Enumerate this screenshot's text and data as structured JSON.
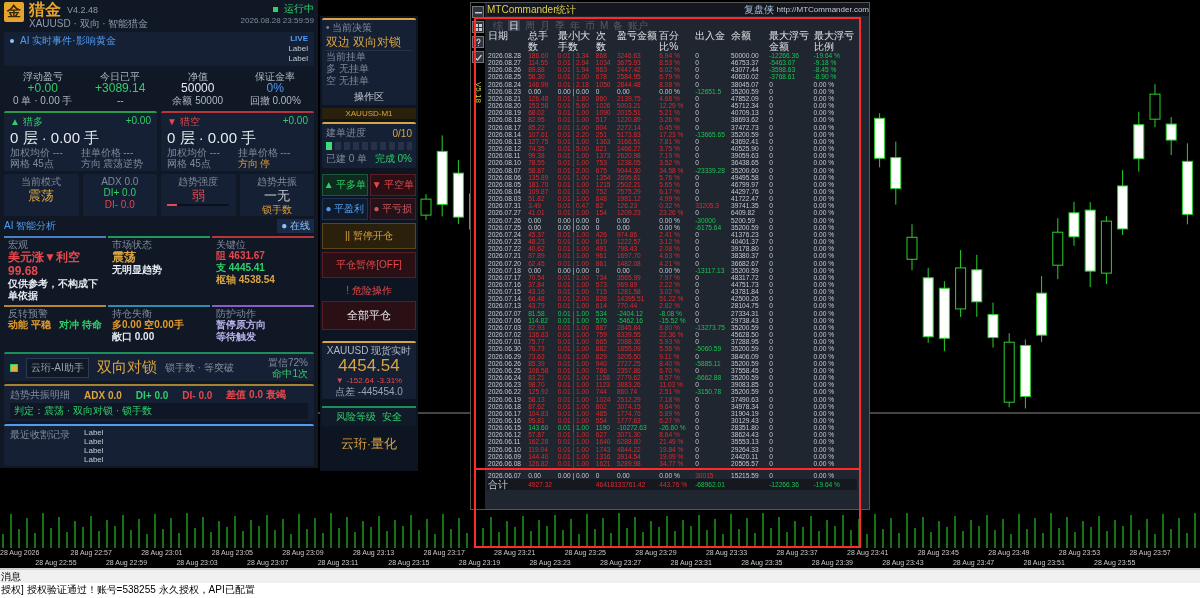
{
  "header": {
    "logo": "金",
    "title": "猎金",
    "version": "V4.2.48",
    "subtitle": "XAUUSD · 双向 · 智能猎金",
    "status": "运行中",
    "running": true,
    "datetime": "2026.08.28 23:59:59"
  },
  "news": {
    "text": "AI 实时事件·影响黄金",
    "badge": "LIVE",
    "labels": [
      "Label",
      "Label"
    ]
  },
  "stats": [
    {
      "label": "浮动盈亏",
      "value": "+0.00",
      "sub": "0 单 · 0.00 手",
      "color": "#2fcf6a"
    },
    {
      "label": "今日已平",
      "value": "+3089.14",
      "sub": "--",
      "color": "#2fcf6a"
    },
    {
      "label": "净值",
      "value": "50000",
      "sub": "余额 50000",
      "color": "#e6ebf2"
    },
    {
      "label": "保证金率",
      "value": "0%",
      "sub": "回撤 0.00%",
      "color": "#4f9cf0"
    }
  ],
  "sides": [
    {
      "kind": "long",
      "arrow": "▲",
      "name": "猎多",
      "pnl": "+0.00",
      "position": "0 层 · 0.00 手",
      "fields": [
        {
          "text": "加权均价 ---",
          "highlight": false
        },
        {
          "text": "挂单价格 ---",
          "highlight": false
        },
        {
          "text": "网格 45点",
          "highlight": false
        },
        {
          "text": "方向 震荡逆势",
          "highlight": false
        }
      ]
    },
    {
      "kind": "short",
      "arrow": "▼",
      "name": "猎空",
      "pnl": "+0.00",
      "position": "0 层 · 0.00 手",
      "fields": [
        {
          "text": "加权均价 ---",
          "highlight": false
        },
        {
          "text": "挂单价格 ---",
          "highlight": false
        },
        {
          "text": "网格 45点",
          "highlight": false
        },
        {
          "text": "方向 停",
          "highlight": true
        }
      ]
    }
  ],
  "indicators": [
    {
      "kind": "mode",
      "label": "当前模式",
      "value": "震荡"
    },
    {
      "kind": "adx",
      "label": "ADX 0.0",
      "plus": "DI+ 0.0",
      "minus": "DI- 0.0"
    },
    {
      "kind": "strength",
      "label": "趋势强度",
      "value": "弱",
      "level": 0.15
    },
    {
      "kind": "resonance",
      "label": "趋势共振",
      "value": "一无",
      "sub": "锁手数"
    }
  ],
  "ai": {
    "title": "AI 智能分析",
    "badge": "● 在线",
    "cards": [
      {
        "kind": "headline",
        "title": "宏观",
        "color": "#4a7fc1",
        "lines": [
          {
            "text": "美元涨▼利空 99.68",
            "color": "#e5484d"
          },
          {
            "text": "仅供参考，不构成下单依据",
            "color": "#e6ebf2"
          }
        ]
      },
      {
        "kind": "headline",
        "title": "市场状态",
        "color": "#1b9a5a",
        "lines": [
          {
            "text": "震荡",
            "color": "#d9a441"
          },
          {
            "text": "无明显趋势",
            "color": "#e6ebf2"
          }
        ]
      },
      {
        "kind": "list",
        "title": "关键位",
        "color": "#b8353a",
        "lines": [
          {
            "text": "阻 4631.67",
            "color": "#e5484d"
          },
          {
            "text": "支 4445.41",
            "color": "#2fcf6a"
          },
          {
            "text": "枢轴 4538.54",
            "color": "#d9a441"
          }
        ]
      },
      {
        "kind": "list",
        "title": "反转预警",
        "color": "#b8862f",
        "lines": [
          {
            "text": "动能 平稳",
            "color": "#e39b2d"
          },
          {
            "text": "对冲 待命",
            "color": "#2fcf6a"
          }
        ]
      },
      {
        "kind": "list",
        "title": "持仓失衡",
        "color": "#2a8fb0",
        "lines": [
          {
            "text": "多0.00 空0.00手",
            "color": "#e39b2d"
          },
          {
            "text": "敞口 0.00",
            "color": "#e6ebf2"
          }
        ]
      },
      {
        "kind": "list",
        "title": "防护动作",
        "color": "#8a5cc8",
        "lines": [
          {
            "text": "暂停原方向",
            "color": "#b9b3ec"
          },
          {
            "text": "等待触发",
            "color": "#b9b3ec"
          }
        ]
      }
    ]
  },
  "strategy": {
    "assistant": "云珩-AI助手",
    "name": "双向对锁",
    "mode": "锁手数 · 等突破",
    "confidence": "置信72%",
    "hits": "命中1次"
  },
  "resonance": {
    "title": "趋势共振明细",
    "items": [
      {
        "text": "ADX 0.0",
        "color": "#d9a441"
      },
      {
        "text": "DI+ 0.0",
        "color": "#2fcf6a"
      },
      {
        "text": "DI- 0.0",
        "color": "#e5484d"
      },
      {
        "text": "差值 0.0 衰竭",
        "color": "#e5484d"
      }
    ],
    "verdict": "判定：震荡 · 双向对锁 · 锁手数"
  },
  "harvest_log": {
    "title": "最近收割记录",
    "entries": [
      "Label",
      "Label",
      "Label",
      "Label"
    ]
  },
  "decision": {
    "title": "• 当前决策",
    "value": "双边 双向对锁",
    "pending_title": "当前挂单",
    "pending": [
      "多 无挂单",
      "空 无挂单"
    ],
    "footer": "操作区"
  },
  "symbol": "XAUUSD-M1",
  "progress": {
    "title": "建单进度",
    "count": "0/10",
    "level": 0.1,
    "built": "已建 0 单",
    "done": "完成 0%"
  },
  "actions": [
    {
      "label": "▲ 平多单",
      "kind": "close-long"
    },
    {
      "label": "▼ 平空单",
      "kind": "close-short"
    },
    {
      "label": "● 平盈利",
      "kind": "close-profit"
    },
    {
      "label": "● 平亏损",
      "kind": "close-loss"
    }
  ],
  "pause_buttons": [
    {
      "label": "|| 暂停开仓",
      "kind": "pause-open"
    },
    {
      "label": "平仓暂停[OFF]",
      "kind": "pause-close"
    }
  ],
  "danger": {
    "title": "! 危险操作",
    "button": "全部平仓"
  },
  "quote": {
    "title": "XAUUSD 现货实时",
    "price": "4454.54",
    "arrow": "▼",
    "change": "-152.64",
    "percent": "-3.31%",
    "spread": "点差 -445454.0"
  },
  "risk": {
    "label": "风险等级",
    "value": "安全"
  },
  "brand": "云珩·量化",
  "stats_window": {
    "title": "MTCommander统计",
    "brand": "复盘侠",
    "url": "http://MTCommander.com",
    "version": "V5.18",
    "tabs": [
      {
        "label": "综",
        "selected": false
      },
      {
        "label": "日",
        "selected": true
      },
      {
        "label": "周",
        "selected": false
      },
      {
        "label": "月",
        "selected": false
      },
      {
        "label": "季",
        "selected": false
      },
      {
        "label": "年",
        "selected": false
      },
      {
        "label": "币",
        "selected": false
      },
      {
        "label": "M",
        "selected": false
      },
      {
        "label": "备",
        "selected": false
      },
      {
        "label": "账户",
        "selected": false
      }
    ],
    "columns": [
      "日期",
      "总手数",
      "最小|大手数",
      "次数",
      "盈亏金额",
      "百分比%",
      "出入金",
      "余额",
      "最大浮亏金额",
      "最大浮亏比例"
    ],
    "rows": [
      {
        "kind": "profit",
        "cells": [
          "2026.08.28",
          "186.60",
          "0.01 | 3.34",
          "868",
          "3246.63",
          "6.94 %"
        ],
        "flow": {
          "text": "0",
          "kind": "none"
        },
        "balance": "50000.00",
        "drawdown": {
          "amount": "-12266.36",
          "percent": "-19.64 %",
          "kind": "loss"
        }
      },
      {
        "kind": "profit",
        "cells": [
          "2026.08.27",
          "114.55",
          "0.01 | 2.94",
          "1034",
          "3675.93",
          "8.53 %"
        ],
        "flow": {
          "text": "0",
          "kind": "none"
        },
        "balance": "46753.37",
        "drawdown": {
          "amount": "-5463.07",
          "percent": "-9.18 %",
          "kind": "loss"
        }
      },
      {
        "kind": "profit",
        "cells": [
          "2026.08.26",
          "89.88",
          "0.01 | 1.94",
          "963",
          "2447.42",
          "6.02 %"
        ],
        "flow": {
          "text": "0",
          "kind": "none"
        },
        "balance": "43077.44",
        "drawdown": {
          "amount": "-3598.63",
          "percent": "-8.45 %",
          "kind": "loss"
        }
      },
      {
        "kind": "profit",
        "cells": [
          "2026.08.25",
          "56.30",
          "0.01 | 1.00",
          "678",
          "2584.95",
          "6.79 %"
        ],
        "flow": {
          "text": "0",
          "kind": "none"
        },
        "balance": "40630.02",
        "drawdown": {
          "amount": "-3768.61",
          "percent": "-8.90 %",
          "kind": "loss"
        }
      },
      {
        "kind": "profit",
        "cells": [
          "2026.08.24",
          "146.99",
          "0.01 | 2.18",
          "1050",
          "2844.48",
          "8.08 %"
        ],
        "flow": {
          "text": "0",
          "kind": "none"
        },
        "balance": "38045.07",
        "drawdown": {
          "amount": "0",
          "percent": "0.00 %",
          "kind": "none"
        }
      },
      {
        "kind": "flat",
        "cells": [
          "2026.08.23",
          "0.00",
          "0.00 | 0.00",
          "0",
          "0.00",
          "0.00 %"
        ],
        "flow": {
          "text": "-12651.5",
          "kind": "withdrawal"
        },
        "balance": "35200.59",
        "drawdown": {
          "amount": "0",
          "percent": "0.00 %",
          "kind": "none"
        }
      },
      {
        "kind": "profit",
        "cells": [
          "2026.08.21",
          "126.48",
          "0.01 | 1.80",
          "860",
          "2139.75",
          "4.68 %"
        ],
        "flow": {
          "text": "0",
          "kind": "none"
        },
        "balance": "47852.09",
        "drawdown": {
          "amount": "0",
          "percent": "0.00 %",
          "kind": "none"
        }
      },
      {
        "kind": "profit",
        "cells": [
          "2026.08.20",
          "153.58",
          "0.01 | 5.60",
          "1026",
          "5003.21",
          "12.29 %"
        ],
        "flow": {
          "text": "0",
          "kind": "none"
        },
        "balance": "45712.34",
        "drawdown": {
          "amount": "0",
          "percent": "0.00 %",
          "kind": "none"
        }
      },
      {
        "kind": "profit",
        "cells": [
          "2026.08.19",
          "68.02",
          "0.01 | 1.00",
          "1090",
          "2015.51",
          "5.21 %"
        ],
        "flow": {
          "text": "0",
          "kind": "none"
        },
        "balance": "40709.13",
        "drawdown": {
          "amount": "0",
          "percent": "0.00 %",
          "kind": "none"
        }
      },
      {
        "kind": "profit",
        "cells": [
          "2026.08.18",
          "82.95",
          "0.01 | 1.00",
          "517",
          "1220.89",
          "3.26 %"
        ],
        "flow": {
          "text": "0",
          "kind": "none"
        },
        "balance": "38693.62",
        "drawdown": {
          "amount": "0",
          "percent": "0.00 %",
          "kind": "none"
        }
      },
      {
        "kind": "profit",
        "cells": [
          "2026.08.17",
          "85.22",
          "0.01 | 1.00",
          "804",
          "2272.14",
          "6.45 %"
        ],
        "flow": {
          "text": "0",
          "kind": "none"
        },
        "balance": "37472.73",
        "drawdown": {
          "amount": "0",
          "percent": "0.00 %",
          "kind": "none"
        }
      },
      {
        "kind": "profit",
        "cells": [
          "2026.08.14",
          "107.61",
          "0.01 | 2.20",
          "251",
          "5173.83",
          "17.23 %"
        ],
        "flow": {
          "text": "-13665.65",
          "kind": "withdrawal"
        },
        "balance": "35200.59",
        "drawdown": {
          "amount": "0",
          "percent": "0.00 %",
          "kind": "none"
        }
      },
      {
        "kind": "profit",
        "cells": [
          "2026.08.13",
          "127.75",
          "0.01 | 1.00",
          "1363",
          "3166.51",
          "7.81 %"
        ],
        "flow": {
          "text": "0",
          "kind": "none"
        },
        "balance": "43692.41",
        "drawdown": {
          "amount": "0",
          "percent": "0.00 %",
          "kind": "none"
        }
      },
      {
        "kind": "profit",
        "cells": [
          "2026.08.12",
          "74.35",
          "0.01 | 5.00",
          "821",
          "1466.27",
          "3.75 %"
        ],
        "flow": {
          "text": "0",
          "kind": "none"
        },
        "balance": "40525.90",
        "drawdown": {
          "amount": "0",
          "percent": "0.00 %",
          "kind": "none"
        }
      },
      {
        "kind": "profit",
        "cells": [
          "2026.08.11",
          "99.38",
          "0.01 | 1.00",
          "1373",
          "2620.98",
          "7.19 %"
        ],
        "flow": {
          "text": "0",
          "kind": "none"
        },
        "balance": "39059.63",
        "drawdown": {
          "amount": "0",
          "percent": "0.00 %",
          "kind": "none"
        }
      },
      {
        "kind": "profit",
        "cells": [
          "2026.08.10",
          "78.55",
          "0.01 | 1.00",
          "753",
          "1238.05",
          "3.52 %"
        ],
        "flow": {
          "text": "0",
          "kind": "none"
        },
        "balance": "36438.65",
        "drawdown": {
          "amount": "0",
          "percent": "0.00 %",
          "kind": "none"
        }
      },
      {
        "kind": "profit",
        "cells": [
          "2026.08.07",
          "58.87",
          "0.01 | 2.00",
          "675",
          "9044.30",
          "34.58 %"
        ],
        "flow": {
          "text": "-23339.28",
          "kind": "withdrawal"
        },
        "balance": "35200.60",
        "drawdown": {
          "amount": "0",
          "percent": "0.00 %",
          "kind": "none"
        }
      },
      {
        "kind": "profit",
        "cells": [
          "2026.08.06",
          "135.89",
          "0.01 | 1.00",
          "1354",
          "2695.61",
          "5.76 %"
        ],
        "flow": {
          "text": "0",
          "kind": "none"
        },
        "balance": "49495.58",
        "drawdown": {
          "amount": "0",
          "percent": "0.00 %",
          "kind": "none"
        }
      },
      {
        "kind": "profit",
        "cells": [
          "2026.08.05",
          "181.70",
          "0.01 | 1.00",
          "1215",
          "2502.21",
          "5.65 %"
        ],
        "flow": {
          "text": "0",
          "kind": "none"
        },
        "balance": "46799.97",
        "drawdown": {
          "amount": "0",
          "percent": "0.00 %",
          "kind": "none"
        }
      },
      {
        "kind": "profit",
        "cells": [
          "2026.08.04",
          "109.87",
          "0.01 | 1.00",
          "752",
          "2575.29",
          "6.17 %"
        ],
        "flow": {
          "text": "0",
          "kind": "none"
        },
        "balance": "44297.76",
        "drawdown": {
          "amount": "0",
          "percent": "0.00 %",
          "kind": "none"
        }
      },
      {
        "kind": "profit",
        "cells": [
          "2026.08.03",
          "51.82",
          "0.01 | 1.00",
          "848",
          "1981.12",
          "4.99 %"
        ],
        "flow": {
          "text": "0",
          "kind": "none"
        },
        "balance": "41722.47",
        "drawdown": {
          "amount": "0",
          "percent": "0.00 %",
          "kind": "none"
        }
      },
      {
        "kind": "profit",
        "cells": [
          "2026.07.31",
          "3.49",
          "0.01 | 0.47",
          "82",
          "126.23",
          "0.32 %"
        ],
        "flow": {
          "text": "33205.3",
          "kind": "deposit"
        },
        "balance": "39741.35",
        "drawdown": {
          "amount": "0",
          "percent": "0.00 %",
          "kind": "none"
        }
      },
      {
        "kind": "profit",
        "cells": [
          "2026.07.27",
          "41.01",
          "0.01 | 1.00",
          "154",
          "1209.23",
          "23.26 %"
        ],
        "flow": {
          "text": "0",
          "kind": "none"
        },
        "balance": "6409.82",
        "drawdown": {
          "amount": "0",
          "percent": "0.00 %",
          "kind": "none"
        }
      },
      {
        "kind": "flat",
        "cells": [
          "2026.07.26",
          "0.00",
          "0.00 | 0.00",
          "0",
          "0.00",
          "0.00 %"
        ],
        "flow": {
          "text": "-30000",
          "kind": "withdrawal"
        },
        "balance": "5200.59",
        "drawdown": {
          "amount": "0",
          "percent": "0.00 %",
          "kind": "none"
        }
      },
      {
        "kind": "flat",
        "cells": [
          "2026.07.25",
          "0.00",
          "0.00 | 0.00",
          "0",
          "0.00",
          "0.00 %"
        ],
        "flow": {
          "text": "-6175.64",
          "kind": "withdrawal"
        },
        "balance": "35200.59",
        "drawdown": {
          "amount": "0",
          "percent": "0.00 %",
          "kind": "none"
        }
      },
      {
        "kind": "profit",
        "cells": [
          "2026.07.24",
          "45.37",
          "0.01 | 1.00",
          "426",
          "974.86",
          "2.41 %"
        ],
        "flow": {
          "text": "0",
          "kind": "none"
        },
        "balance": "41376.23",
        "drawdown": {
          "amount": "0",
          "percent": "0.00 %",
          "kind": "none"
        }
      },
      {
        "kind": "profit",
        "cells": [
          "2026.07.23",
          "48.23",
          "0.01 | 1.00",
          "619",
          "1222.57",
          "3.12 %"
        ],
        "flow": {
          "text": "0",
          "kind": "none"
        },
        "balance": "40401.37",
        "drawdown": {
          "amount": "0",
          "percent": "0.00 %",
          "kind": "none"
        }
      },
      {
        "kind": "profit",
        "cells": [
          "2026.07.22",
          "40.62",
          "0.01 | 1.00",
          "491",
          "798.43",
          "2.08 %"
        ],
        "flow": {
          "text": "0",
          "kind": "none"
        },
        "balance": "39178.80",
        "drawdown": {
          "amount": "0",
          "percent": "0.00 %",
          "kind": "none"
        }
      },
      {
        "kind": "profit",
        "cells": [
          "2026.07.21",
          "87.89",
          "0.01 | 1.00",
          "961",
          "1697.70",
          "4.63 %"
        ],
        "flow": {
          "text": "0",
          "kind": "none"
        },
        "balance": "38380.37",
        "drawdown": {
          "amount": "0",
          "percent": "0.00 %",
          "kind": "none"
        }
      },
      {
        "kind": "profit",
        "cells": [
          "2026.07.20",
          "62.45",
          "0.01 | 1.00",
          "861",
          "1482.08",
          "4.21 %"
        ],
        "flow": {
          "text": "0",
          "kind": "none"
        },
        "balance": "36682.67",
        "drawdown": {
          "amount": "0",
          "percent": "0.00 %",
          "kind": "none"
        }
      },
      {
        "kind": "flat",
        "cells": [
          "2026.07.18",
          "0.00",
          "0.00 | 0.00",
          "0",
          "0.00",
          "0.00 %"
        ],
        "flow": {
          "text": "-13117.13",
          "kind": "withdrawal"
        },
        "balance": "35200.59",
        "drawdown": {
          "amount": "0",
          "percent": "0.00 %",
          "kind": "none"
        }
      },
      {
        "kind": "profit",
        "cells": [
          "2026.07.17",
          "70.54",
          "0.01 | 1.00",
          "734",
          "3565.99",
          "7.97 %"
        ],
        "flow": {
          "text": "0",
          "kind": "none"
        },
        "balance": "48317.72",
        "drawdown": {
          "amount": "0",
          "percent": "0.00 %",
          "kind": "none"
        }
      },
      {
        "kind": "profit",
        "cells": [
          "2026.07.16",
          "37.84",
          "0.01 | 1.00",
          "573",
          "969.89",
          "2.22 %"
        ],
        "flow": {
          "text": "0",
          "kind": "none"
        },
        "balance": "44751.73",
        "drawdown": {
          "amount": "0",
          "percent": "0.00 %",
          "kind": "none"
        }
      },
      {
        "kind": "profit",
        "cells": [
          "2026.07.15",
          "43.16",
          "0.01 | 1.00",
          "715",
          "1281.58",
          "3.02 %"
        ],
        "flow": {
          "text": "0",
          "kind": "none"
        },
        "balance": "43781.84",
        "drawdown": {
          "amount": "0",
          "percent": "0.00 %",
          "kind": "none"
        }
      },
      {
        "kind": "profit",
        "cells": [
          "2026.07.14",
          "66.48",
          "0.01 | 2.00",
          "828",
          "14395.51",
          "51.22 %"
        ],
        "flow": {
          "text": "0",
          "kind": "none"
        },
        "balance": "42500.26",
        "drawdown": {
          "amount": "0",
          "percent": "0.00 %",
          "kind": "none"
        }
      },
      {
        "kind": "profit",
        "cells": [
          "2026.07.13",
          "43.79",
          "0.01 | 1.00",
          "614",
          "770.44",
          "2.82 %"
        ],
        "flow": {
          "text": "0",
          "kind": "none"
        },
        "balance": "28104.75",
        "drawdown": {
          "amount": "0",
          "percent": "0.00 %",
          "kind": "none"
        }
      },
      {
        "kind": "loss",
        "cells": [
          "2026.07.07",
          "81.58",
          "0.01 | 1.00",
          "534",
          "-2404.12",
          "-8.08 %"
        ],
        "flow": {
          "text": "0",
          "kind": "none"
        },
        "balance": "27334.31",
        "drawdown": {
          "amount": "0",
          "percent": "0.00 %",
          "kind": "none"
        }
      },
      {
        "kind": "loss",
        "cells": [
          "2026.07.06",
          "114.82",
          "0.01 | 1.00",
          "576",
          "-5462.16",
          "-15.52 %"
        ],
        "flow": {
          "text": "0",
          "kind": "none"
        },
        "balance": "29738.43",
        "drawdown": {
          "amount": "0",
          "percent": "0.00 %",
          "kind": "none"
        }
      },
      {
        "kind": "profit",
        "cells": [
          "2026.07.03",
          "82.93",
          "0.01 | 1.00",
          "887",
          "2845.84",
          "8.80 %"
        ],
        "flow": {
          "text": "-13273.75",
          "kind": "withdrawal"
        },
        "balance": "35200.59",
        "drawdown": {
          "amount": "0",
          "percent": "0.00 %",
          "kind": "none"
        }
      },
      {
        "kind": "profit",
        "cells": [
          "2026.07.02",
          "136.83",
          "0.01 | 1.00",
          "759",
          "8339.55",
          "22.36 %"
        ],
        "flow": {
          "text": "0",
          "kind": "none"
        },
        "balance": "45628.50",
        "drawdown": {
          "amount": "0",
          "percent": "0.00 %",
          "kind": "none"
        }
      },
      {
        "kind": "profit",
        "cells": [
          "2026.07.01",
          "75.77",
          "0.01 | 1.00",
          "665",
          "2088.36",
          "5.93 %"
        ],
        "flow": {
          "text": "0",
          "kind": "none"
        },
        "balance": "37288.95",
        "drawdown": {
          "amount": "0",
          "percent": "0.00 %",
          "kind": "none"
        }
      },
      {
        "kind": "profit",
        "cells": [
          "2026.06.30",
          "76.73",
          "0.01 | 1.00",
          "882",
          "1855.09",
          "5.56 %"
        ],
        "flow": {
          "text": "-5060.59",
          "kind": "withdrawal"
        },
        "balance": "35200.59",
        "drawdown": {
          "amount": "0",
          "percent": "0.00 %",
          "kind": "none"
        }
      },
      {
        "kind": "profit",
        "cells": [
          "2026.06.29",
          "73.63",
          "0.01 | 1.00",
          "829",
          "3205.50",
          "9.11 %"
        ],
        "flow": {
          "text": "0",
          "kind": "none"
        },
        "balance": "38406.09",
        "drawdown": {
          "amount": "0",
          "percent": "0.00 %",
          "kind": "none"
        }
      },
      {
        "kind": "profit",
        "cells": [
          "2026.06.26",
          "85.39",
          "0.01 | 1.00",
          "940",
          "2727.25",
          "8.40 %"
        ],
        "flow": {
          "text": "-5885.11",
          "kind": "withdrawal"
        },
        "balance": "35200.59",
        "drawdown": {
          "amount": "0",
          "percent": "0.00 %",
          "kind": "none"
        }
      },
      {
        "kind": "profit",
        "cells": [
          "2026.06.25",
          "106.58",
          "0.01 | 1.00",
          "786",
          "2357.86",
          "6.70 %"
        ],
        "flow": {
          "text": "0",
          "kind": "none"
        },
        "balance": "37558.45",
        "drawdown": {
          "amount": "0",
          "percent": "0.00 %",
          "kind": "none"
        }
      },
      {
        "kind": "profit",
        "cells": [
          "2026.06.24",
          "83.21",
          "0.01 | 1.00",
          "1158",
          "2779.62",
          "8.57 %"
        ],
        "flow": {
          "text": "-6662.88",
          "kind": "withdrawal"
        },
        "balance": "35200.59",
        "drawdown": {
          "amount": "0",
          "percent": "0.00 %",
          "kind": "none"
        }
      },
      {
        "kind": "profit",
        "cells": [
          "2026.06.23",
          "98.70",
          "0.01 | 1.00",
          "1123",
          "3883.26",
          "11.03 %"
        ],
        "flow": {
          "text": "0",
          "kind": "none"
        },
        "balance": "39083.85",
        "drawdown": {
          "amount": "0",
          "percent": "0.00 %",
          "kind": "none"
        }
      },
      {
        "kind": "profit",
        "cells": [
          "2026.06.22",
          "125.92",
          "0.01 | 1.00",
          "744",
          "860.74",
          "2.51 %"
        ],
        "flow": {
          "text": "-3150.78",
          "kind": "withdrawal"
        },
        "balance": "35200.59",
        "drawdown": {
          "amount": "0",
          "percent": "0.00 %",
          "kind": "none"
        }
      },
      {
        "kind": "profit",
        "cells": [
          "2026.06.19",
          "58.13",
          "0.01 | 1.00",
          "1024",
          "2512.29",
          "7.18 %"
        ],
        "flow": {
          "text": "0",
          "kind": "none"
        },
        "balance": "37490.63",
        "drawdown": {
          "amount": "0",
          "percent": "0.00 %",
          "kind": "none"
        }
      },
      {
        "kind": "profit",
        "cells": [
          "2026.06.18",
          "87.62",
          "0.01 | 1.00",
          "802",
          "3074.15",
          "9.64 %"
        ],
        "flow": {
          "text": "0",
          "kind": "none"
        },
        "balance": "34978.34",
        "drawdown": {
          "amount": "0",
          "percent": "0.00 %",
          "kind": "none"
        }
      },
      {
        "kind": "profit",
        "cells": [
          "2026.06.17",
          "104.83",
          "0.01 | 1.00",
          "485",
          "1774.76",
          "5.89 %"
        ],
        "flow": {
          "text": "0",
          "kind": "none"
        },
        "balance": "31904.19",
        "drawdown": {
          "amount": "0",
          "percent": "0.00 %",
          "kind": "none"
        }
      },
      {
        "kind": "profit",
        "cells": [
          "2026.06.16",
          "95.81",
          "0.01 | 1.00",
          "554",
          "1777.63",
          "6.27 %"
        ],
        "flow": {
          "text": "0",
          "kind": "none"
        },
        "balance": "30129.43",
        "drawdown": {
          "amount": "0",
          "percent": "0.00 %",
          "kind": "none"
        }
      },
      {
        "kind": "loss",
        "cells": [
          "2026.06.15",
          "143.60",
          "0.01 | 1.00",
          "1190",
          "-10272.63",
          "-26.60 %"
        ],
        "flow": {
          "text": "0",
          "kind": "none"
        },
        "balance": "28351.80",
        "drawdown": {
          "amount": "0",
          "percent": "0.00 %",
          "kind": "none"
        }
      },
      {
        "kind": "profit",
        "cells": [
          "2026.06.12",
          "57.87",
          "0.01 | 1.00",
          "627",
          "3071.30",
          "8.64 %"
        ],
        "flow": {
          "text": "0",
          "kind": "none"
        },
        "balance": "38624.43",
        "drawdown": {
          "amount": "0",
          "percent": "0.00 %",
          "kind": "none"
        }
      },
      {
        "kind": "profit",
        "cells": [
          "2026.06.11",
          "162.28",
          "0.01 | 1.00",
          "1640",
          "6288.80",
          "21.49 %"
        ],
        "flow": {
          "text": "0",
          "kind": "none"
        },
        "balance": "35553.13",
        "drawdown": {
          "amount": "0",
          "percent": "0.00 %",
          "kind": "none"
        }
      },
      {
        "kind": "profit",
        "cells": [
          "2026.06.10",
          "119.04",
          "0.01 | 1.00",
          "1743",
          "4844.22",
          "19.84 %"
        ],
        "flow": {
          "text": "0",
          "kind": "none"
        },
        "balance": "29264.33",
        "drawdown": {
          "amount": "0",
          "percent": "0.00 %",
          "kind": "none"
        }
      },
      {
        "kind": "profit",
        "cells": [
          "2026.06.09",
          "144.40",
          "0.01 | 1.00",
          "1316",
          "3914.54",
          "19.09 %"
        ],
        "flow": {
          "text": "0",
          "kind": "none"
        },
        "balance": "24420.11",
        "drawdown": {
          "amount": "0",
          "percent": "0.00 %",
          "kind": "none"
        }
      },
      {
        "kind": "profit",
        "cells": [
          "2026.06.08",
          "126.82",
          "0.01 | 1.00",
          "1621",
          "5289.98",
          "34.77 %"
        ],
        "flow": {
          "text": "0",
          "kind": "none"
        },
        "balance": "20505.57",
        "drawdown": {
          "amount": "0",
          "percent": "0.00 %",
          "kind": "none"
        }
      },
      {
        "kind": "flat",
        "cells": [
          "2026.06.07",
          "0.00",
          "0.00 | 0.00",
          "0",
          "0.00",
          "0.00 %"
        ],
        "flow": {
          "text": "30015",
          "kind": "deposit"
        },
        "balance": "15215.59",
        "drawdown": {
          "amount": "0",
          "percent": "0.00 %",
          "kind": "none"
        }
      }
    ],
    "total": {
      "kind": "profit",
      "label": "合计",
      "lots": "4927.32",
      "count_pnl": "46418133761.42",
      "percent": "443.76 %",
      "flow": {
        "text": "-68962.01",
        "kind": "withdrawal"
      },
      "drawdown": {
        "amount": "-12266.36",
        "percent": "-19.64 %",
        "kind": "loss"
      }
    }
  },
  "time_axis": [
    "28 Aug 2026",
    "28 Aug 22:55",
    "28 Aug 22:57",
    "28 Aug 22:59",
    "28 Aug 23:01",
    "28 Aug 23:03",
    "28 Aug 23:05",
    "28 Aug 23:07",
    "28 Aug 23:09",
    "28 Aug 23:11",
    "28 Aug 23:13",
    "28 Aug 23:15",
    "28 Aug 23:17",
    "28 Aug 23:19",
    "28 Aug 23:21",
    "28 Aug 23:23",
    "28 Aug 23:25",
    "28 Aug 23:27",
    "28 Aug 23:29",
    "28 Aug 23:31",
    "28 Aug 23:33",
    "28 Aug 23:35",
    "28 Aug 23:37",
    "28 Aug 23:39",
    "28 Aug 23:41",
    "28 Aug 23:43",
    "28 Aug 23:45",
    "28 Aug 23:47",
    "28 Aug 23:49",
    "28 Aug 23:51",
    "28 Aug 23:53",
    "28 Aug 23:55",
    "28 Aug 23:57"
  ],
  "messages": {
    "title": "消息",
    "lines": [
      "授权] 授权验证通过！账号=538255 永久授权，API已配置"
    ]
  }
}
